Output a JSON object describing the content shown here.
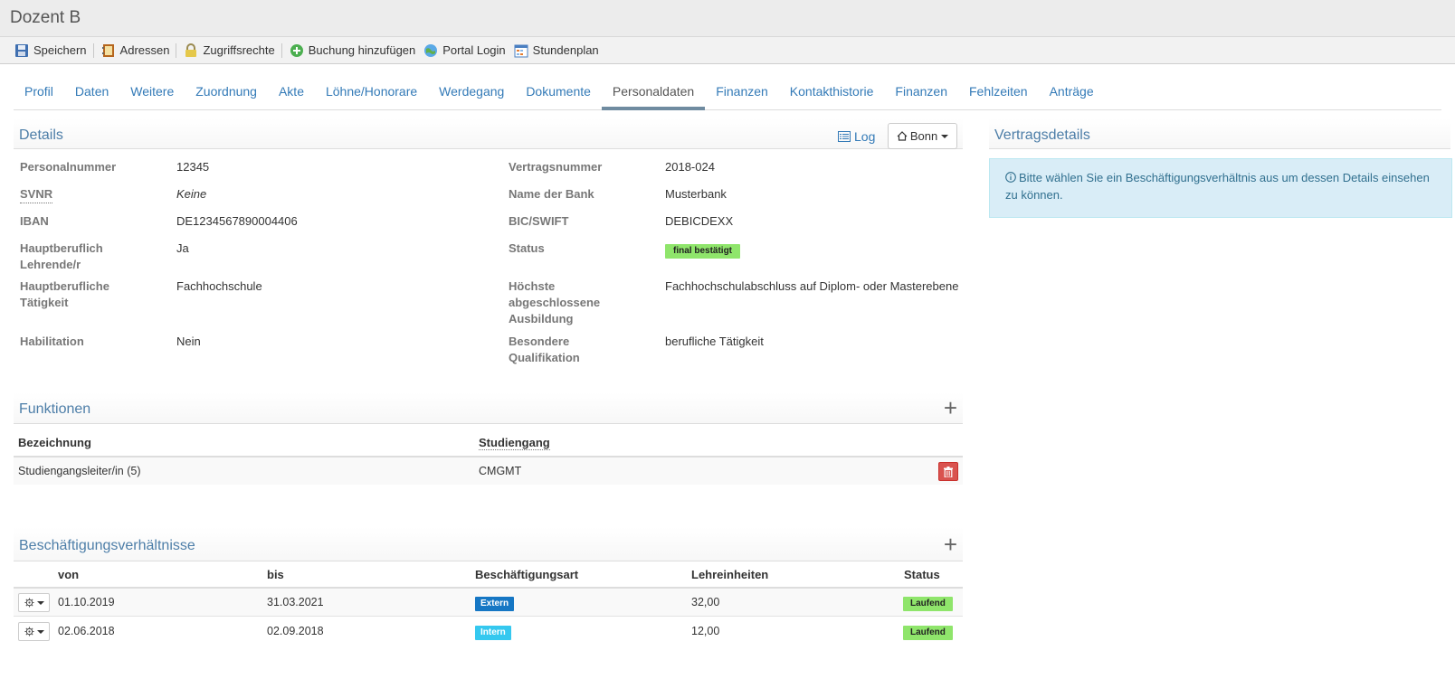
{
  "window_title": "Dozent B",
  "toolbar": [
    {
      "label": "Speichern",
      "icon": "save-icon"
    },
    {
      "label": "Adressen",
      "icon": "address-book-icon"
    },
    {
      "label": "Zugriffsrechte",
      "icon": "lock-icon"
    },
    {
      "label": "Buchung hinzufügen",
      "icon": "add-circle-icon"
    },
    {
      "label": "Portal Login",
      "icon": "globe-icon"
    },
    {
      "label": "Stundenplan",
      "icon": "calendar-icon"
    }
  ],
  "tabs": [
    "Profil",
    "Daten",
    "Weitere",
    "Zuordnung",
    "Akte",
    "Löhne/Honorare",
    "Werdegang",
    "Dokumente",
    "Personaldaten",
    "Finanzen",
    "Kontakthistorie",
    "Finanzen",
    "Fehlzeiten",
    "Anträge"
  ],
  "active_tab": "Personaldaten",
  "details": {
    "title": "Details",
    "log_label": "Log",
    "location_label": "Bonn",
    "left": [
      {
        "label": "Personalnummer",
        "value": "12345"
      },
      {
        "label": "SVNR",
        "value": "Keine"
      },
      {
        "label": "IBAN",
        "value": "DE1234567890004406"
      },
      {
        "label": "Hauptberuflich Lehrende/r",
        "value": "Ja"
      },
      {
        "label": "Hauptberufliche Tätigkeit",
        "value": "Fachhochschule"
      },
      {
        "label": "Habilitation",
        "value": "Nein"
      }
    ],
    "right": [
      {
        "label": "Vertragsnummer",
        "value": "2018-024"
      },
      {
        "label": "Name der Bank",
        "value": "Musterbank"
      },
      {
        "label": "BIC/SWIFT",
        "value": "DEBICDEXX"
      },
      {
        "label": "Status",
        "value": "final bestätigt"
      },
      {
        "label": "Höchste abgeschlossene Ausbildung",
        "value": "Fachhochschulabschluss auf Diplom- oder Masterebene"
      },
      {
        "label": "Besondere Qualifikation",
        "value": "berufliche Tätigkeit"
      }
    ]
  },
  "funktionen": {
    "title": "Funktionen",
    "columns": [
      "Bezeichnung",
      "Studiengang"
    ],
    "rows": [
      {
        "bezeichnung": "Studiengangsleiter/in (5)",
        "studiengang": "CMGMT"
      }
    ]
  },
  "beschaeftigung": {
    "title": "Beschäftigungsverhältnisse",
    "columns": [
      "von",
      "bis",
      "Beschäftigungsart",
      "Lehreinheiten",
      "Status"
    ],
    "rows": [
      {
        "von": "01.10.2019",
        "bis": "31.03.2021",
        "art": "Extern",
        "lehreinheiten": "32,00",
        "status": "Laufend"
      },
      {
        "von": "02.06.2018",
        "bis": "02.09.2018",
        "art": "Intern",
        "lehreinheiten": "12,00",
        "status": "Laufend"
      }
    ]
  },
  "vertragsdetails": {
    "title": "Vertragsdetails",
    "info": "Bitte wählen Sie ein Beschäftigungsverhältnis aus um dessen Details einsehen zu können."
  },
  "colors": {
    "link": "#337ab7",
    "status_green": "#8fe56b",
    "extern_blue": "#1677c4",
    "intern_cyan": "#35c8ef",
    "danger": "#d9534f",
    "info_bg": "#d9edf7"
  }
}
